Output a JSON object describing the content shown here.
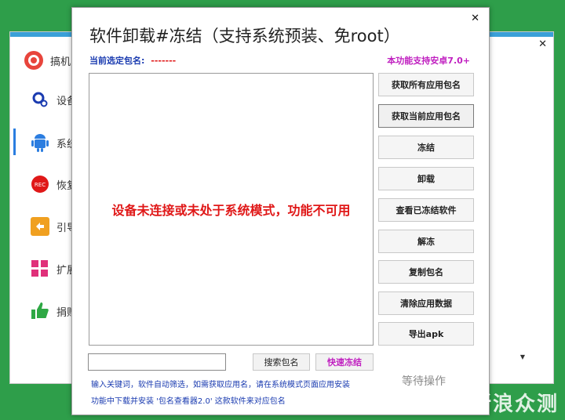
{
  "background_app": {
    "sidebar": [
      {
        "label": "搞机",
        "icon": "logo-icon"
      },
      {
        "label": "设备",
        "icon": "gear-icon"
      },
      {
        "label": "系统",
        "icon": "android-icon"
      },
      {
        "label": "恢复",
        "icon": "rec-icon"
      },
      {
        "label": "引导",
        "icon": "back-arrow-icon"
      },
      {
        "label": "扩展",
        "icon": "grid-icon"
      },
      {
        "label": "捐赠",
        "icon": "thumbs-up-icon"
      }
    ],
    "rec_badge": "REC",
    "close_glyph": "✕"
  },
  "dialog": {
    "title": "软件卸载#冻结（支持系统预装、免root）",
    "close_glyph": "✕",
    "current_pkg_label": "当前选定包名:",
    "current_pkg_value": "-------",
    "android_note": "本功能支持安卓7.0+",
    "empty_message": "设备未连接或未处于系统模式，功能不可用",
    "buttons": [
      "获取所有应用包名",
      "获取当前应用包名",
      "冻结",
      "卸载",
      "查看已冻结软件",
      "解冻",
      "复制包名",
      "清除应用数据",
      "导出apk"
    ],
    "search_button": "搜索包名",
    "quick_freeze_button": "快速冻结",
    "status": "等待操作",
    "hint_line1": "输入关键词，软件自动筛选，如需获取应用名，请在系统模式页面应用安装",
    "hint_line2": "功能中下载并安装 '包名查看器2.0' 这款软件来对应包名"
  },
  "colors": {
    "desktop_green": "#2e9e4a",
    "accent_blue": "#1a3bb0",
    "error_red": "#e01818",
    "magenta": "#c020c0"
  },
  "watermark": "新浪众测"
}
